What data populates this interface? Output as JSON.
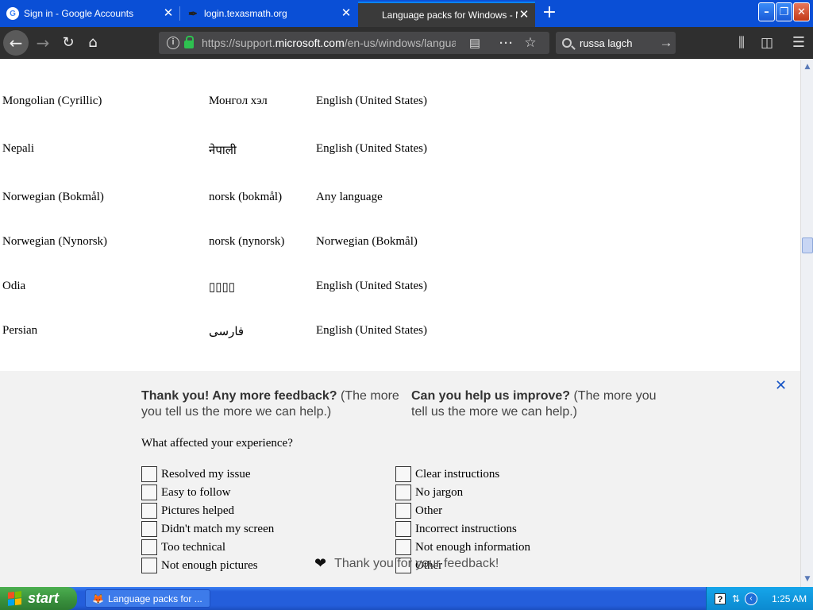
{
  "tabs": [
    {
      "label": "Sign in - Google Accounts",
      "active": false
    },
    {
      "label": "login.texasmath.org",
      "active": false
    },
    {
      "label": "Language packs for Windows - Mi",
      "active": true
    }
  ],
  "window_controls": {
    "minimize": "–",
    "maximize": "❐",
    "close": "✕"
  },
  "nav": {
    "back": "←",
    "forward": "→",
    "reload": "↻",
    "home": "⌂"
  },
  "url": {
    "prefix": "https://support.",
    "domain": "microsoft.com",
    "rest": "/en-us/windows/langua"
  },
  "search": {
    "value": "russa lagch"
  },
  "languages": [
    {
      "name": "Mongolian (Cyrillic)",
      "native": "Монгол хэл",
      "base": "English (United States)"
    },
    {
      "name": "Nepali",
      "native": "नेपाली",
      "base": "English (United States)"
    },
    {
      "name": "Norwegian (Bokmål)",
      "native": "norsk (bokmål)",
      "base": "Any language"
    },
    {
      "name": "Norwegian (Nynorsk)",
      "native": "norsk (nynorsk)",
      "base": "Norwegian (Bokmål)"
    },
    {
      "name": "Odia",
      "native": "▯▯▯▯",
      "base": "English (United States)"
    },
    {
      "name": "Persian",
      "native": "فارسی",
      "base": "English (United States)"
    }
  ],
  "feedback": {
    "left_heading_bold": "Thank you! Any more feedback?",
    "left_heading_rest": " (The more you tell us the more we can help.)",
    "right_heading_bold": "Can you help us improve?",
    "right_heading_rest": " (The more you tell us the more we can help.)",
    "question": "What affected your experience?",
    "left_options": [
      "Resolved my issue",
      "Easy to follow",
      "Pictures helped",
      "Didn't match my screen",
      "Too technical",
      "Not enough pictures"
    ],
    "right_options": [
      "Clear instructions",
      "No jargon",
      "Other",
      "Incorrect instructions",
      "Not enough information",
      "Other"
    ],
    "thanks": "Thank you for your feedback!",
    "close": "✕"
  },
  "taskbar": {
    "start": "start",
    "task_label": "Language packs for ...",
    "clock": "1:25 AM"
  }
}
